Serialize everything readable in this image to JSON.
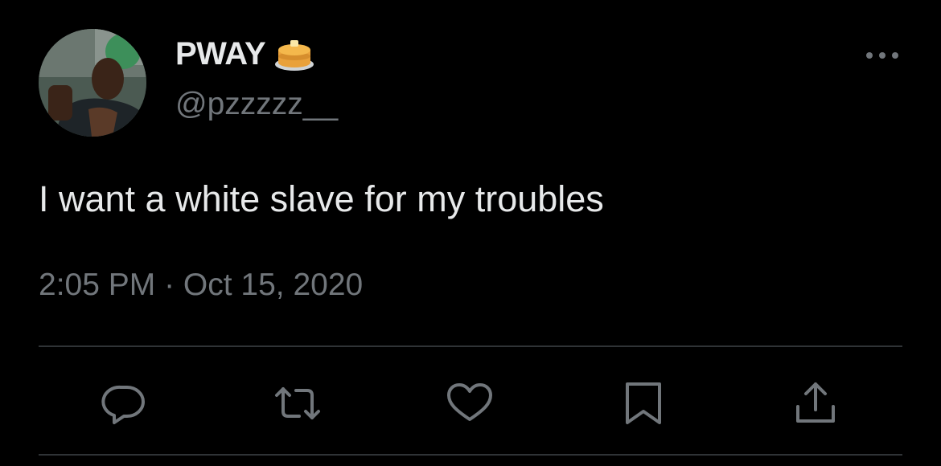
{
  "user": {
    "display_name": "PWAY",
    "handle": "@pzzzzz__",
    "name_emoji": "pancake-icon",
    "avatar": "user-avatar-photo"
  },
  "tweet": {
    "text": "I want a white slave for my troubles",
    "timestamp": "2:05 PM · Oct 15, 2020"
  },
  "actions": [
    {
      "name": "reply",
      "icon": "speech-bubble-icon"
    },
    {
      "name": "retweet",
      "icon": "retweet-arrows-icon"
    },
    {
      "name": "like",
      "icon": "heart-icon"
    },
    {
      "name": "bookmark",
      "icon": "bookmark-icon"
    },
    {
      "name": "share",
      "icon": "share-upload-icon"
    }
  ],
  "colors": {
    "background": "#000000",
    "primary_text": "#e7e9ea",
    "secondary_text": "#71767b",
    "divider": "#2f3336",
    "icon": "#71767b"
  }
}
